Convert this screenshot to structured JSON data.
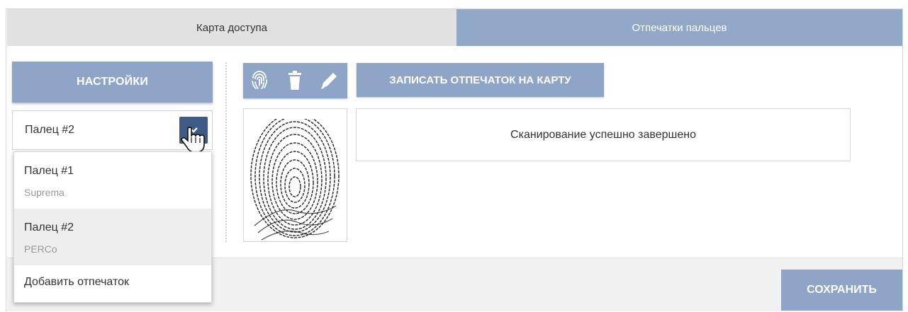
{
  "tabs": [
    {
      "label": "Карта доступа",
      "active": false
    },
    {
      "label": "Отпечатки пальцев",
      "active": true
    }
  ],
  "settings_button": {
    "label": "НАСТРОЙКИ"
  },
  "finger_select": {
    "value": "Палец #2",
    "options": [
      {
        "name": "Палец #1",
        "vendor": "Suprema"
      },
      {
        "name": "Палец #2",
        "vendor": "PERCo",
        "highlighted": true
      }
    ],
    "add_label": "Добавить отпечаток"
  },
  "toolbar": {
    "icons": [
      "fingerprint-icon",
      "trash-icon",
      "pencil-icon"
    ],
    "write_label": "ЗАПИСАТЬ ОТПЕЧАТОК НА КАРТУ"
  },
  "status": {
    "message": "Сканирование успешно завершено"
  },
  "footer": {
    "save_label": "СОХРАНИТЬ"
  },
  "colors": {
    "accent": "#8ea5c7",
    "active_tab": "#92a8c8",
    "inactive_tab": "#e1e1e1",
    "select_toggle": "#3e5a85"
  }
}
